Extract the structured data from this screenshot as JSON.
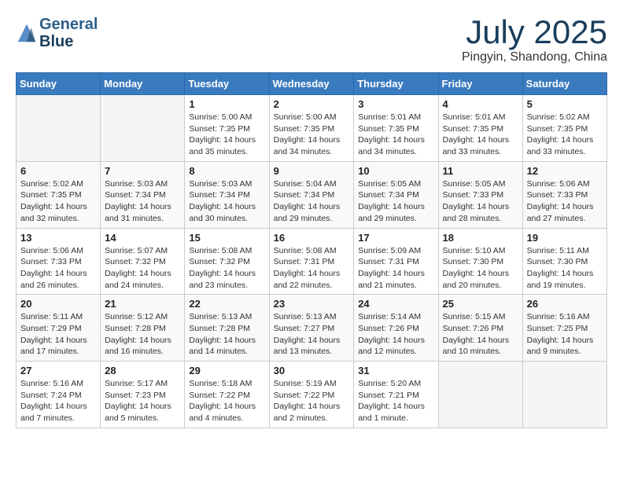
{
  "header": {
    "logo_line1": "General",
    "logo_line2": "Blue",
    "month": "July 2025",
    "location": "Pingyin, Shandong, China"
  },
  "weekdays": [
    "Sunday",
    "Monday",
    "Tuesday",
    "Wednesday",
    "Thursday",
    "Friday",
    "Saturday"
  ],
  "weeks": [
    [
      {
        "day": "",
        "empty": true
      },
      {
        "day": "",
        "empty": true
      },
      {
        "day": "1",
        "sunrise": "5:00 AM",
        "sunset": "7:35 PM",
        "daylight": "14 hours and 35 minutes."
      },
      {
        "day": "2",
        "sunrise": "5:00 AM",
        "sunset": "7:35 PM",
        "daylight": "14 hours and 34 minutes."
      },
      {
        "day": "3",
        "sunrise": "5:01 AM",
        "sunset": "7:35 PM",
        "daylight": "14 hours and 34 minutes."
      },
      {
        "day": "4",
        "sunrise": "5:01 AM",
        "sunset": "7:35 PM",
        "daylight": "14 hours and 33 minutes."
      },
      {
        "day": "5",
        "sunrise": "5:02 AM",
        "sunset": "7:35 PM",
        "daylight": "14 hours and 33 minutes."
      }
    ],
    [
      {
        "day": "6",
        "sunrise": "5:02 AM",
        "sunset": "7:35 PM",
        "daylight": "14 hours and 32 minutes."
      },
      {
        "day": "7",
        "sunrise": "5:03 AM",
        "sunset": "7:34 PM",
        "daylight": "14 hours and 31 minutes."
      },
      {
        "day": "8",
        "sunrise": "5:03 AM",
        "sunset": "7:34 PM",
        "daylight": "14 hours and 30 minutes."
      },
      {
        "day": "9",
        "sunrise": "5:04 AM",
        "sunset": "7:34 PM",
        "daylight": "14 hours and 29 minutes."
      },
      {
        "day": "10",
        "sunrise": "5:05 AM",
        "sunset": "7:34 PM",
        "daylight": "14 hours and 29 minutes."
      },
      {
        "day": "11",
        "sunrise": "5:05 AM",
        "sunset": "7:33 PM",
        "daylight": "14 hours and 28 minutes."
      },
      {
        "day": "12",
        "sunrise": "5:06 AM",
        "sunset": "7:33 PM",
        "daylight": "14 hours and 27 minutes."
      }
    ],
    [
      {
        "day": "13",
        "sunrise": "5:06 AM",
        "sunset": "7:33 PM",
        "daylight": "14 hours and 26 minutes."
      },
      {
        "day": "14",
        "sunrise": "5:07 AM",
        "sunset": "7:32 PM",
        "daylight": "14 hours and 24 minutes."
      },
      {
        "day": "15",
        "sunrise": "5:08 AM",
        "sunset": "7:32 PM",
        "daylight": "14 hours and 23 minutes."
      },
      {
        "day": "16",
        "sunrise": "5:08 AM",
        "sunset": "7:31 PM",
        "daylight": "14 hours and 22 minutes."
      },
      {
        "day": "17",
        "sunrise": "5:09 AM",
        "sunset": "7:31 PM",
        "daylight": "14 hours and 21 minutes."
      },
      {
        "day": "18",
        "sunrise": "5:10 AM",
        "sunset": "7:30 PM",
        "daylight": "14 hours and 20 minutes."
      },
      {
        "day": "19",
        "sunrise": "5:11 AM",
        "sunset": "7:30 PM",
        "daylight": "14 hours and 19 minutes."
      }
    ],
    [
      {
        "day": "20",
        "sunrise": "5:11 AM",
        "sunset": "7:29 PM",
        "daylight": "14 hours and 17 minutes."
      },
      {
        "day": "21",
        "sunrise": "5:12 AM",
        "sunset": "7:28 PM",
        "daylight": "14 hours and 16 minutes."
      },
      {
        "day": "22",
        "sunrise": "5:13 AM",
        "sunset": "7:28 PM",
        "daylight": "14 hours and 14 minutes."
      },
      {
        "day": "23",
        "sunrise": "5:13 AM",
        "sunset": "7:27 PM",
        "daylight": "14 hours and 13 minutes."
      },
      {
        "day": "24",
        "sunrise": "5:14 AM",
        "sunset": "7:26 PM",
        "daylight": "14 hours and 12 minutes."
      },
      {
        "day": "25",
        "sunrise": "5:15 AM",
        "sunset": "7:26 PM",
        "daylight": "14 hours and 10 minutes."
      },
      {
        "day": "26",
        "sunrise": "5:16 AM",
        "sunset": "7:25 PM",
        "daylight": "14 hours and 9 minutes."
      }
    ],
    [
      {
        "day": "27",
        "sunrise": "5:16 AM",
        "sunset": "7:24 PM",
        "daylight": "14 hours and 7 minutes."
      },
      {
        "day": "28",
        "sunrise": "5:17 AM",
        "sunset": "7:23 PM",
        "daylight": "14 hours and 5 minutes."
      },
      {
        "day": "29",
        "sunrise": "5:18 AM",
        "sunset": "7:22 PM",
        "daylight": "14 hours and 4 minutes."
      },
      {
        "day": "30",
        "sunrise": "5:19 AM",
        "sunset": "7:22 PM",
        "daylight": "14 hours and 2 minutes."
      },
      {
        "day": "31",
        "sunrise": "5:20 AM",
        "sunset": "7:21 PM",
        "daylight": "14 hours and 1 minute."
      },
      {
        "day": "",
        "empty": true
      },
      {
        "day": "",
        "empty": true
      }
    ]
  ]
}
